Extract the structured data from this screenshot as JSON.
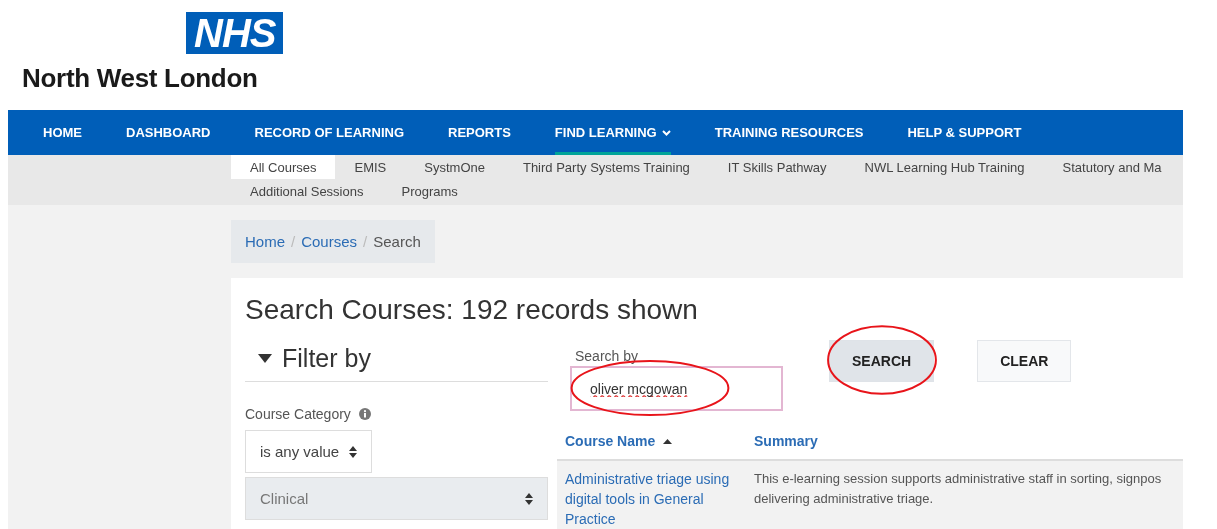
{
  "logo": {
    "badge": "NHS",
    "region": "North West London"
  },
  "nav": {
    "items": [
      {
        "label": "HOME",
        "selected": false,
        "has_menu": false
      },
      {
        "label": "DASHBOARD",
        "selected": false,
        "has_menu": false
      },
      {
        "label": "RECORD OF LEARNING",
        "selected": false,
        "has_menu": false
      },
      {
        "label": "REPORTS",
        "selected": false,
        "has_menu": false
      },
      {
        "label": "FIND LEARNING",
        "selected": true,
        "has_menu": true
      },
      {
        "label": "TRAINING RESOURCES",
        "selected": false,
        "has_menu": false
      },
      {
        "label": "HELP & SUPPORT",
        "selected": false,
        "has_menu": false
      }
    ]
  },
  "subnav": {
    "rows": [
      [
        {
          "label": "All Courses",
          "selected": true
        },
        {
          "label": "EMIS",
          "selected": false
        },
        {
          "label": "SystmOne",
          "selected": false
        },
        {
          "label": "Third Party Systems Training",
          "selected": false
        },
        {
          "label": "IT Skills Pathway",
          "selected": false
        },
        {
          "label": "NWL Learning Hub Training",
          "selected": false
        },
        {
          "label": "Statutory and Ma",
          "selected": false
        }
      ],
      [
        {
          "label": "Additional Sessions",
          "selected": false
        },
        {
          "label": "Programs",
          "selected": false
        }
      ]
    ]
  },
  "breadcrumb": [
    {
      "label": "Home",
      "current": false
    },
    {
      "separator": "/",
      "label": "Courses",
      "current": false
    },
    {
      "separator": "/",
      "label": "Search",
      "current": true
    }
  ],
  "heading": "Search Courses: 192 records shown",
  "filter": {
    "title": "Filter by",
    "expanded": true,
    "category_label": "Course Category",
    "operator": "is any value",
    "value": "Clinical"
  },
  "search": {
    "label": "Search by",
    "value": "oliver mcgowan",
    "annotated": true
  },
  "buttons": [
    {
      "label": "SEARCH",
      "annotated": true,
      "primary": true
    },
    {
      "label": "CLEAR",
      "annotated": false,
      "primary": false
    }
  ],
  "table": {
    "columns": [
      {
        "label": "Course Name",
        "sorted": true
      },
      {
        "label": "Summary",
        "sorted": false
      }
    ],
    "rows": [
      {
        "name": "Administrative triage using digital tools in General Practice",
        "summary": [
          "This e-learning session supports administrative staff in sorting, signpos",
          "delivering administrative triage."
        ]
      }
    ]
  }
}
